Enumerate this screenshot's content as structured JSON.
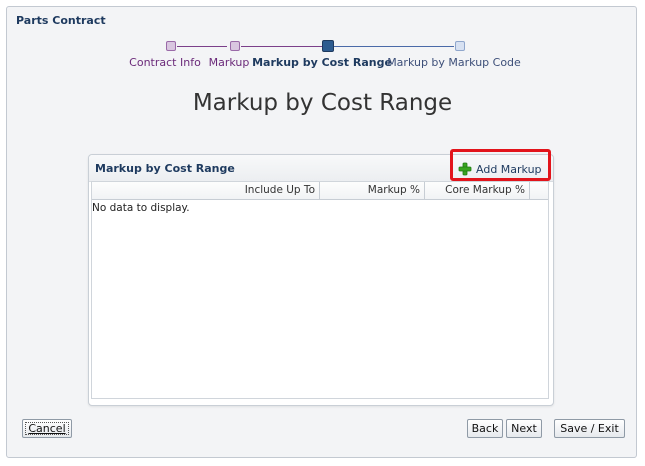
{
  "window": {
    "title": "Parts Contract"
  },
  "train": {
    "steps": [
      {
        "label": "Contract Info",
        "state": "visited"
      },
      {
        "label": "Markup",
        "state": "visited"
      },
      {
        "label": "Markup by Cost Range",
        "state": "current"
      },
      {
        "label": "Markup by Markup Code",
        "state": "unvisited"
      }
    ]
  },
  "page": {
    "heading": "Markup by Cost Range"
  },
  "panel": {
    "title": "Markup by Cost Range",
    "add_button_label": "Add Markup",
    "add_icon": "plus-icon",
    "columns": [
      "Include Up To",
      "Markup %",
      "Core Markup %"
    ],
    "empty_message": "No data to display."
  },
  "footer": {
    "cancel_label": "Cancel",
    "back_label": "Back",
    "next_label": "Next",
    "save_exit_label": "Save / Exit"
  },
  "colors": {
    "visited_step": "#6b2a7a",
    "current_step": "#1e3a5f",
    "unvisited_step": "#3d4f79",
    "highlight": "#e2141b",
    "plus_icon": "#3aa521"
  }
}
